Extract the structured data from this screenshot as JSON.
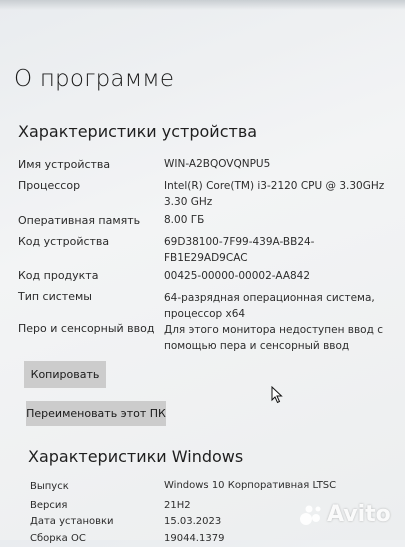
{
  "page": {
    "title": "О программе"
  },
  "device": {
    "title": "Характеристики устройства",
    "rows": [
      {
        "label": "Имя устройства",
        "value": [
          "WIN-A2BQOVQNPU5"
        ]
      },
      {
        "label": "Процессор",
        "value": [
          "Intel(R) Core(TM) i3-2120 CPU @ 3.30GHz",
          "3.30 GHz"
        ]
      },
      {
        "label": "Оперативная память",
        "value": [
          "8.00 ГБ"
        ]
      },
      {
        "label": "Код устройства",
        "value": [
          "69D38100-7F99-439A-BB24-",
          "FB1E29AD9CAC"
        ]
      },
      {
        "label": "Код продукта",
        "value": [
          "00425-00000-00002-AA842"
        ]
      },
      {
        "label": "Тип системы",
        "value": [
          "64-разрядная операционная система,",
          "процессор x64"
        ]
      },
      {
        "label": "Перо и сенсорный ввод",
        "value": [
          "Для этого монитора недоступен ввод с",
          "помощью пера и сенсорный ввод"
        ]
      }
    ],
    "copy_button": "Копировать",
    "rename_button": "Переименовать этот ПК"
  },
  "windows": {
    "title": "Характеристики Windows",
    "rows": [
      {
        "label": "Выпуск",
        "value": [
          "Windows 10 Корпоративная LTSC"
        ]
      },
      {
        "label": "Версия",
        "value": [
          "21H2"
        ]
      },
      {
        "label": "Дата установки",
        "value": [
          "15.03.2023"
        ]
      },
      {
        "label": "Сборка ОС",
        "value": [
          "19044.1379"
        ]
      }
    ]
  },
  "watermark": {
    "text": "Avito",
    "icon": "avito-logo-icon"
  }
}
